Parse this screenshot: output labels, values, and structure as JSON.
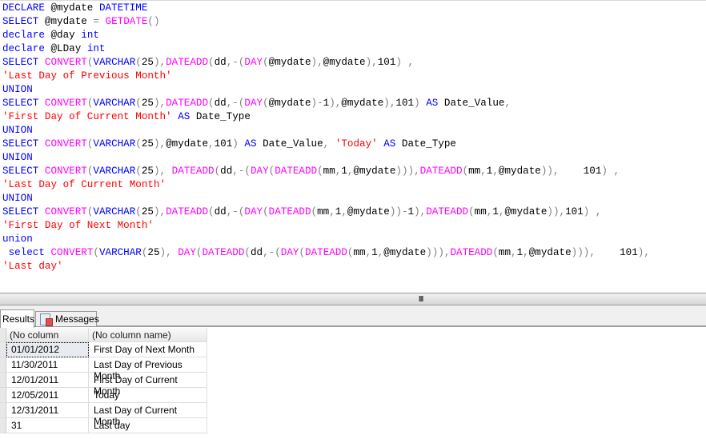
{
  "editor": {
    "lines": [
      [
        [
          "k",
          "DECLARE"
        ],
        [
          "t",
          " @mydate "
        ],
        [
          "k",
          "DATETIME"
        ]
      ],
      [
        [
          "k",
          "SELECT"
        ],
        [
          "t",
          " @mydate "
        ],
        [
          "o",
          "="
        ],
        [
          "t",
          " "
        ],
        [
          "f",
          "GETDATE"
        ],
        [
          "o",
          "()"
        ]
      ],
      [
        [
          "k",
          "declare"
        ],
        [
          "t",
          " @day "
        ],
        [
          "k",
          "int"
        ]
      ],
      [
        [
          "k",
          "declare"
        ],
        [
          "t",
          " @LDay "
        ],
        [
          "k",
          "int"
        ]
      ],
      [
        [
          "k",
          "SELECT"
        ],
        [
          "t",
          " "
        ],
        [
          "f",
          "CONVERT"
        ],
        [
          "o",
          "("
        ],
        [
          "k",
          "VARCHAR"
        ],
        [
          "o",
          "("
        ],
        [
          "t",
          "25"
        ],
        [
          "o",
          "),"
        ],
        [
          "f",
          "DATEADD"
        ],
        [
          "o",
          "("
        ],
        [
          "t",
          "dd"
        ],
        [
          "o",
          ",-("
        ],
        [
          "f",
          "DAY"
        ],
        [
          "o",
          "("
        ],
        [
          "t",
          "@mydate"
        ],
        [
          "o",
          "),"
        ],
        [
          "t",
          "@mydate"
        ],
        [
          "o",
          "),"
        ],
        [
          "t",
          "101"
        ],
        [
          "o",
          ")"
        ],
        [
          "t",
          " "
        ],
        [
          "o",
          ","
        ]
      ],
      [
        [
          "s",
          "'Last Day of Previous Month'"
        ]
      ],
      [
        [
          "k",
          "UNION"
        ]
      ],
      [
        [
          "k",
          "SELECT"
        ],
        [
          "t",
          " "
        ],
        [
          "f",
          "CONVERT"
        ],
        [
          "o",
          "("
        ],
        [
          "k",
          "VARCHAR"
        ],
        [
          "o",
          "("
        ],
        [
          "t",
          "25"
        ],
        [
          "o",
          "),"
        ],
        [
          "f",
          "DATEADD"
        ],
        [
          "o",
          "("
        ],
        [
          "t",
          "dd"
        ],
        [
          "o",
          ",-("
        ],
        [
          "f",
          "DAY"
        ],
        [
          "o",
          "("
        ],
        [
          "t",
          "@mydate"
        ],
        [
          "o",
          ")-"
        ],
        [
          "t",
          "1"
        ],
        [
          "o",
          "),"
        ],
        [
          "t",
          "@mydate"
        ],
        [
          "o",
          "),"
        ],
        [
          "t",
          "101"
        ],
        [
          "o",
          ")"
        ],
        [
          "t",
          " "
        ],
        [
          "k",
          "AS"
        ],
        [
          "t",
          " Date_Value"
        ],
        [
          "o",
          ","
        ]
      ],
      [
        [
          "s",
          "'First Day of Current Month'"
        ],
        [
          "t",
          " "
        ],
        [
          "k",
          "AS"
        ],
        [
          "t",
          " Date_Type"
        ]
      ],
      [
        [
          "k",
          "UNION"
        ]
      ],
      [
        [
          "k",
          "SELECT"
        ],
        [
          "t",
          " "
        ],
        [
          "f",
          "CONVERT"
        ],
        [
          "o",
          "("
        ],
        [
          "k",
          "VARCHAR"
        ],
        [
          "o",
          "("
        ],
        [
          "t",
          "25"
        ],
        [
          "o",
          "),"
        ],
        [
          "t",
          "@mydate"
        ],
        [
          "o",
          ","
        ],
        [
          "t",
          "101"
        ],
        [
          "o",
          ")"
        ],
        [
          "t",
          " "
        ],
        [
          "k",
          "AS"
        ],
        [
          "t",
          " Date_Value"
        ],
        [
          "o",
          ","
        ],
        [
          "t",
          " "
        ],
        [
          "s",
          "'Today'"
        ],
        [
          "t",
          " "
        ],
        [
          "k",
          "AS"
        ],
        [
          "t",
          " Date_Type"
        ]
      ],
      [
        [
          "k",
          "UNION"
        ]
      ],
      [
        [
          "k",
          "SELECT"
        ],
        [
          "t",
          " "
        ],
        [
          "f",
          "CONVERT"
        ],
        [
          "o",
          "("
        ],
        [
          "k",
          "VARCHAR"
        ],
        [
          "o",
          "("
        ],
        [
          "t",
          "25"
        ],
        [
          "o",
          "),"
        ],
        [
          "t",
          " "
        ],
        [
          "f",
          "DATEADD"
        ],
        [
          "o",
          "("
        ],
        [
          "t",
          "dd"
        ],
        [
          "o",
          ",-("
        ],
        [
          "f",
          "DAY"
        ],
        [
          "o",
          "("
        ],
        [
          "f",
          "DATEADD"
        ],
        [
          "o",
          "("
        ],
        [
          "t",
          "mm"
        ],
        [
          "o",
          ","
        ],
        [
          "t",
          "1"
        ],
        [
          "o",
          ","
        ],
        [
          "t",
          "@mydate"
        ],
        [
          "o",
          ")))"
        ],
        [
          "o",
          ","
        ],
        [
          "f",
          "DATEADD"
        ],
        [
          "o",
          "("
        ],
        [
          "t",
          "mm"
        ],
        [
          "o",
          ","
        ],
        [
          "t",
          "1"
        ],
        [
          "o",
          ","
        ],
        [
          "t",
          "@mydate"
        ],
        [
          "o",
          "))"
        ],
        [
          "o",
          ","
        ],
        [
          "t",
          "    101"
        ],
        [
          "o",
          ")"
        ],
        [
          "t",
          " "
        ],
        [
          "o",
          ","
        ]
      ],
      [
        [
          "s",
          "'Last Day of Current Month'"
        ]
      ],
      [
        [
          "k",
          "UNION"
        ]
      ],
      [
        [
          "k",
          "SELECT"
        ],
        [
          "t",
          " "
        ],
        [
          "f",
          "CONVERT"
        ],
        [
          "o",
          "("
        ],
        [
          "k",
          "VARCHAR"
        ],
        [
          "o",
          "("
        ],
        [
          "t",
          "25"
        ],
        [
          "o",
          "),"
        ],
        [
          "f",
          "DATEADD"
        ],
        [
          "o",
          "("
        ],
        [
          "t",
          "dd"
        ],
        [
          "o",
          ",-("
        ],
        [
          "f",
          "DAY"
        ],
        [
          "o",
          "("
        ],
        [
          "f",
          "DATEADD"
        ],
        [
          "o",
          "("
        ],
        [
          "t",
          "mm"
        ],
        [
          "o",
          ","
        ],
        [
          "t",
          "1"
        ],
        [
          "o",
          ","
        ],
        [
          "t",
          "@mydate"
        ],
        [
          "o",
          "))-"
        ],
        [
          "t",
          "1"
        ],
        [
          "o",
          "),"
        ],
        [
          "f",
          "DATEADD"
        ],
        [
          "o",
          "("
        ],
        [
          "t",
          "mm"
        ],
        [
          "o",
          ","
        ],
        [
          "t",
          "1"
        ],
        [
          "o",
          ","
        ],
        [
          "t",
          "@mydate"
        ],
        [
          "o",
          ")),"
        ],
        [
          "t",
          "101"
        ],
        [
          "o",
          ")"
        ],
        [
          "t",
          " "
        ],
        [
          "o",
          ","
        ]
      ],
      [
        [
          "s",
          "'First Day of Next Month'"
        ]
      ],
      [
        [
          "k",
          "union"
        ]
      ],
      [
        [
          "t",
          " "
        ],
        [
          "k",
          "select"
        ],
        [
          "t",
          " "
        ],
        [
          "f",
          "CONVERT"
        ],
        [
          "o",
          "("
        ],
        [
          "k",
          "VARCHAR"
        ],
        [
          "o",
          "("
        ],
        [
          "t",
          "25"
        ],
        [
          "o",
          "),"
        ],
        [
          "t",
          " "
        ],
        [
          "f",
          "DAY"
        ],
        [
          "o",
          "("
        ],
        [
          "f",
          "DATEADD"
        ],
        [
          "o",
          "("
        ],
        [
          "t",
          "dd"
        ],
        [
          "o",
          ",-("
        ],
        [
          "f",
          "DAY"
        ],
        [
          "o",
          "("
        ],
        [
          "f",
          "DATEADD"
        ],
        [
          "o",
          "("
        ],
        [
          "t",
          "mm"
        ],
        [
          "o",
          ","
        ],
        [
          "t",
          "1"
        ],
        [
          "o",
          ","
        ],
        [
          "t",
          "@mydate"
        ],
        [
          "o",
          ")))"
        ],
        [
          "o",
          ","
        ],
        [
          "f",
          "DATEADD"
        ],
        [
          "o",
          "("
        ],
        [
          "t",
          "mm"
        ],
        [
          "o",
          ","
        ],
        [
          "t",
          "1"
        ],
        [
          "o",
          ","
        ],
        [
          "t",
          "@mydate"
        ],
        [
          "o",
          ")))"
        ],
        [
          "o",
          ","
        ],
        [
          "t",
          "    101"
        ],
        [
          "o",
          "),"
        ]
      ],
      [
        [
          "s",
          "'Last day'"
        ]
      ]
    ]
  },
  "tabs": {
    "results": "Results",
    "messages": "Messages"
  },
  "grid": {
    "headers": [
      "(No column name)",
      "(No column name)"
    ],
    "rows": [
      [
        "01/01/2012",
        "First Day of Next Month"
      ],
      [
        "11/30/2011",
        "Last Day of Previous Month"
      ],
      [
        "12/01/2011",
        "First Day of Current Month"
      ],
      [
        "12/05/2011",
        "Today"
      ],
      [
        "12/31/2011",
        "Last Day of Current Month"
      ],
      [
        "31",
        "Last day"
      ]
    ]
  },
  "splitter": {
    "grip": "III"
  }
}
